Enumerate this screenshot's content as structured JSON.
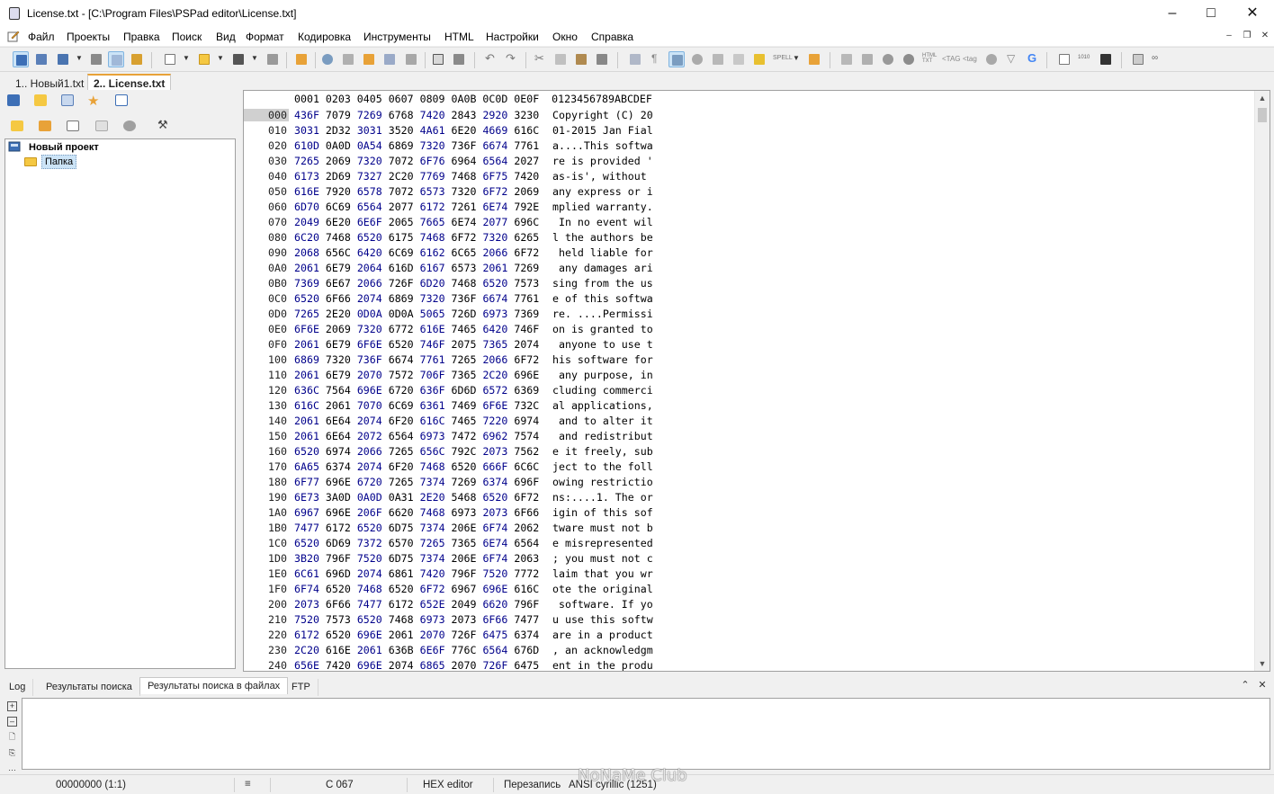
{
  "window": {
    "title": "License.txt - [C:\\Program Files\\PSPad editor\\License.txt]"
  },
  "menu": [
    "Файл",
    "Проекты",
    "Правка",
    "Поиск",
    "Вид",
    "Формат",
    "Кодировка",
    "Инструменты",
    "HTML",
    "Настройки",
    "Окно",
    "Справка"
  ],
  "tabs": {
    "tab1": "1.. Новый1.txt",
    "tab2": "2.. License.txt"
  },
  "tree": {
    "project": "Новый проект",
    "folder": "Папка"
  },
  "hex": {
    "header": "0001 0203 0405 0607 0809 0A0B 0C0D 0E0F  0123456789ABCDEF",
    "rows": [
      {
        "off": "000",
        "b": [
          "436F",
          "7079",
          "7269",
          "6768",
          "7420",
          "2843",
          "2920",
          "3230"
        ],
        "a": "Copyright (C) 20"
      },
      {
        "off": "010",
        "b": [
          "3031",
          "2D32",
          "3031",
          "3520",
          "4A61",
          "6E20",
          "4669",
          "616C"
        ],
        "a": "01-2015 Jan Fial"
      },
      {
        "off": "020",
        "b": [
          "610D",
          "0A0D",
          "0A54",
          "6869",
          "7320",
          "736F",
          "6674",
          "7761"
        ],
        "a": "a....This softwa"
      },
      {
        "off": "030",
        "b": [
          "7265",
          "2069",
          "7320",
          "7072",
          "6F76",
          "6964",
          "6564",
          "2027"
        ],
        "a": "re is provided '"
      },
      {
        "off": "040",
        "b": [
          "6173",
          "2D69",
          "7327",
          "2C20",
          "7769",
          "7468",
          "6F75",
          "7420"
        ],
        "a": "as-is', without "
      },
      {
        "off": "050",
        "b": [
          "616E",
          "7920",
          "6578",
          "7072",
          "6573",
          "7320",
          "6F72",
          "2069"
        ],
        "a": "any express or i"
      },
      {
        "off": "060",
        "b": [
          "6D70",
          "6C69",
          "6564",
          "2077",
          "6172",
          "7261",
          "6E74",
          "792E"
        ],
        "a": "mplied warranty."
      },
      {
        "off": "070",
        "b": [
          "2049",
          "6E20",
          "6E6F",
          "2065",
          "7665",
          "6E74",
          "2077",
          "696C"
        ],
        "a": " In no event wil"
      },
      {
        "off": "080",
        "b": [
          "6C20",
          "7468",
          "6520",
          "6175",
          "7468",
          "6F72",
          "7320",
          "6265"
        ],
        "a": "l the authors be"
      },
      {
        "off": "090",
        "b": [
          "2068",
          "656C",
          "6420",
          "6C69",
          "6162",
          "6C65",
          "2066",
          "6F72"
        ],
        "a": " held liable for"
      },
      {
        "off": "0A0",
        "b": [
          "2061",
          "6E79",
          "2064",
          "616D",
          "6167",
          "6573",
          "2061",
          "7269"
        ],
        "a": " any damages ari"
      },
      {
        "off": "0B0",
        "b": [
          "7369",
          "6E67",
          "2066",
          "726F",
          "6D20",
          "7468",
          "6520",
          "7573"
        ],
        "a": "sing from the us"
      },
      {
        "off": "0C0",
        "b": [
          "6520",
          "6F66",
          "2074",
          "6869",
          "7320",
          "736F",
          "6674",
          "7761"
        ],
        "a": "e of this softwa"
      },
      {
        "off": "0D0",
        "b": [
          "7265",
          "2E20",
          "0D0A",
          "0D0A",
          "5065",
          "726D",
          "6973",
          "7369"
        ],
        "a": "re. ....Permissi"
      },
      {
        "off": "0E0",
        "b": [
          "6F6E",
          "2069",
          "7320",
          "6772",
          "616E",
          "7465",
          "6420",
          "746F"
        ],
        "a": "on is granted to"
      },
      {
        "off": "0F0",
        "b": [
          "2061",
          "6E79",
          "6F6E",
          "6520",
          "746F",
          "2075",
          "7365",
          "2074"
        ],
        "a": " anyone to use t"
      },
      {
        "off": "100",
        "b": [
          "6869",
          "7320",
          "736F",
          "6674",
          "7761",
          "7265",
          "2066",
          "6F72"
        ],
        "a": "his software for"
      },
      {
        "off": "110",
        "b": [
          "2061",
          "6E79",
          "2070",
          "7572",
          "706F",
          "7365",
          "2C20",
          "696E"
        ],
        "a": " any purpose, in"
      },
      {
        "off": "120",
        "b": [
          "636C",
          "7564",
          "696E",
          "6720",
          "636F",
          "6D6D",
          "6572",
          "6369"
        ],
        "a": "cluding commerci"
      },
      {
        "off": "130",
        "b": [
          "616C",
          "2061",
          "7070",
          "6C69",
          "6361",
          "7469",
          "6F6E",
          "732C"
        ],
        "a": "al applications,"
      },
      {
        "off": "140",
        "b": [
          "2061",
          "6E64",
          "2074",
          "6F20",
          "616C",
          "7465",
          "7220",
          "6974"
        ],
        "a": " and to alter it"
      },
      {
        "off": "150",
        "b": [
          "2061",
          "6E64",
          "2072",
          "6564",
          "6973",
          "7472",
          "6962",
          "7574"
        ],
        "a": " and redistribut"
      },
      {
        "off": "160",
        "b": [
          "6520",
          "6974",
          "2066",
          "7265",
          "656C",
          "792C",
          "2073",
          "7562"
        ],
        "a": "e it freely, sub"
      },
      {
        "off": "170",
        "b": [
          "6A65",
          "6374",
          "2074",
          "6F20",
          "7468",
          "6520",
          "666F",
          "6C6C"
        ],
        "a": "ject to the foll"
      },
      {
        "off": "180",
        "b": [
          "6F77",
          "696E",
          "6720",
          "7265",
          "7374",
          "7269",
          "6374",
          "696F"
        ],
        "a": "owing restrictio"
      },
      {
        "off": "190",
        "b": [
          "6E73",
          "3A0D",
          "0A0D",
          "0A31",
          "2E20",
          "5468",
          "6520",
          "6F72"
        ],
        "a": "ns:....1. The or"
      },
      {
        "off": "1A0",
        "b": [
          "6967",
          "696E",
          "206F",
          "6620",
          "7468",
          "6973",
          "2073",
          "6F66"
        ],
        "a": "igin of this sof"
      },
      {
        "off": "1B0",
        "b": [
          "7477",
          "6172",
          "6520",
          "6D75",
          "7374",
          "206E",
          "6F74",
          "2062"
        ],
        "a": "tware must not b"
      },
      {
        "off": "1C0",
        "b": [
          "6520",
          "6D69",
          "7372",
          "6570",
          "7265",
          "7365",
          "6E74",
          "6564"
        ],
        "a": "e misrepresented"
      },
      {
        "off": "1D0",
        "b": [
          "3B20",
          "796F",
          "7520",
          "6D75",
          "7374",
          "206E",
          "6F74",
          "2063"
        ],
        "a": "; you must not c"
      },
      {
        "off": "1E0",
        "b": [
          "6C61",
          "696D",
          "2074",
          "6861",
          "7420",
          "796F",
          "7520",
          "7772"
        ],
        "a": "laim that you wr"
      },
      {
        "off": "1F0",
        "b": [
          "6F74",
          "6520",
          "7468",
          "6520",
          "6F72",
          "6967",
          "696E",
          "616C"
        ],
        "a": "ote the original"
      },
      {
        "off": "200",
        "b": [
          "2073",
          "6F66",
          "7477",
          "6172",
          "652E",
          "2049",
          "6620",
          "796F"
        ],
        "a": " software. If yo"
      },
      {
        "off": "210",
        "b": [
          "7520",
          "7573",
          "6520",
          "7468",
          "6973",
          "2073",
          "6F66",
          "7477"
        ],
        "a": "u use this softw"
      },
      {
        "off": "220",
        "b": [
          "6172",
          "6520",
          "696E",
          "2061",
          "2070",
          "726F",
          "6475",
          "6374"
        ],
        "a": "are in a product"
      },
      {
        "off": "230",
        "b": [
          "2C20",
          "616E",
          "2061",
          "636B",
          "6E6F",
          "776C",
          "6564",
          "676D"
        ],
        "a": ", an acknowledgm"
      },
      {
        "off": "240",
        "b": [
          "656E",
          "7420",
          "696E",
          "2074",
          "6865",
          "2070",
          "726F",
          "6475"
        ],
        "a": "ent in the produ"
      }
    ]
  },
  "bottom_tabs": {
    "log": "Log",
    "search": "Результаты поиска",
    "search_files": "Результаты поиска в файлах",
    "ftp": "FTP"
  },
  "status": {
    "position": "00000000  (1:1)",
    "char": "C  067",
    "mode": "HEX editor",
    "insert": "Перезапись",
    "encoding": "ANSI cyrillic (1251)"
  },
  "watermark": "NoNaMe Club"
}
